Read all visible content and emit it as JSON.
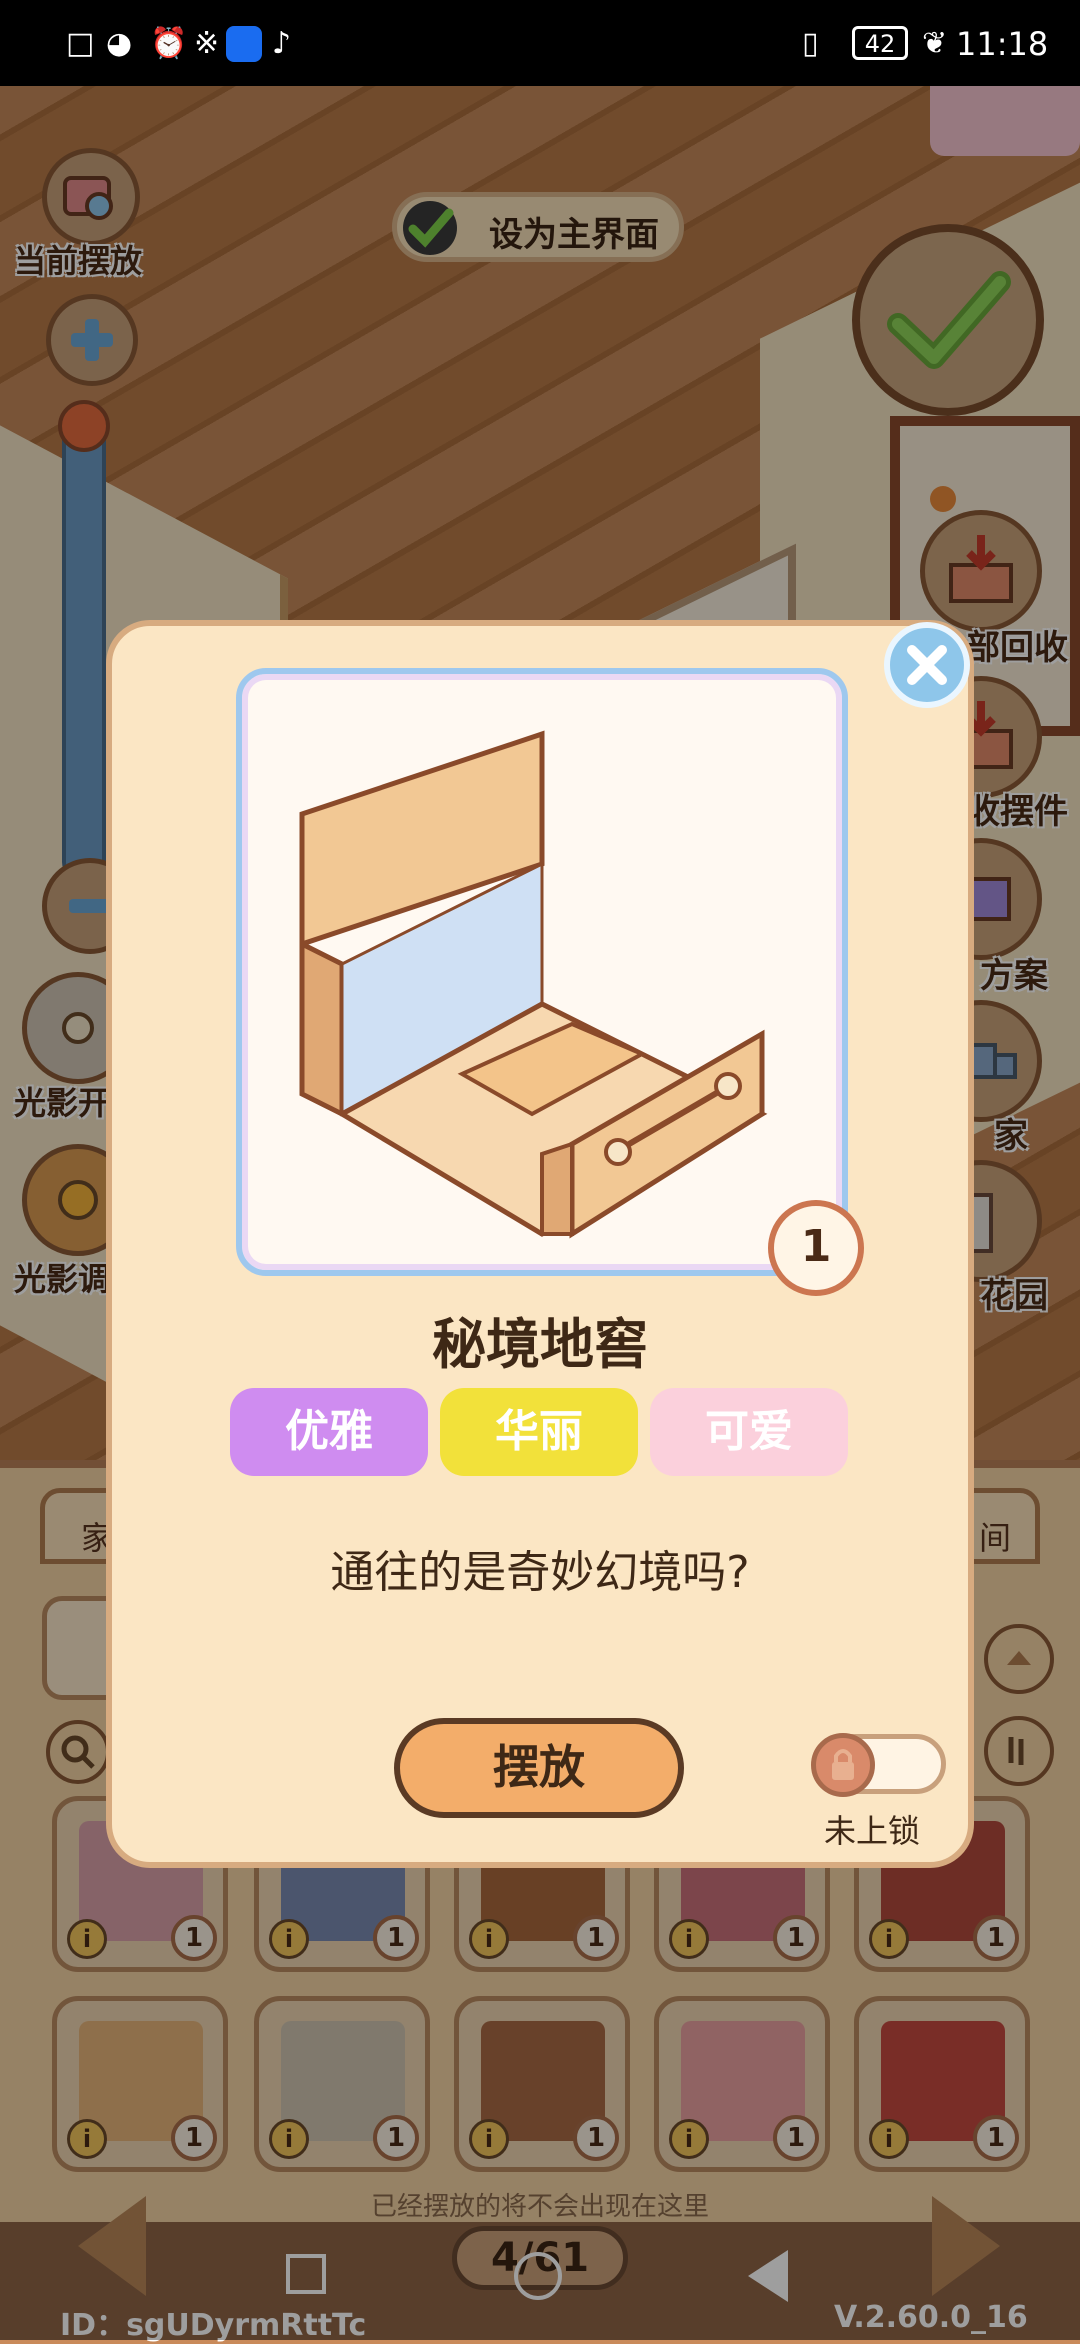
{
  "status_bar": {
    "time": "11:18",
    "battery": "42"
  },
  "scene": {
    "set_main_label": "设为主界面",
    "left_controls": {
      "current_placement_label": "当前摆放",
      "light_toggle_label": "光影开",
      "light_adjust_label": "光影调"
    },
    "right_controls": {
      "recycle_label": "部回收",
      "take_back_label": "收摆件",
      "plan_label": "方案",
      "move_label": "家",
      "garden_label": "花园"
    },
    "tabs": {
      "left": "家",
      "right": "间"
    },
    "items": [
      {
        "count": "1",
        "color": "#d8a0a8"
      },
      {
        "count": "1",
        "color": "#7a8ab0"
      },
      {
        "count": "1",
        "color": "#a8683c"
      },
      {
        "count": "1",
        "color": "#c8707a"
      },
      {
        "count": "1",
        "color": "#b04a3c"
      },
      {
        "count": "1",
        "color": "#e6b47a"
      },
      {
        "count": "1",
        "color": "#cfc4b0"
      },
      {
        "count": "1",
        "color": "#a86a44"
      },
      {
        "count": "1",
        "color": "#e8a0a0"
      },
      {
        "count": "1",
        "color": "#c44a40"
      }
    ],
    "hint": "已经摆放的将不会出现在这里",
    "page_indicator": "4/61",
    "user_id": "ID：sgUDyrmRttTc",
    "version": "V.2.60.0_16"
  },
  "modal": {
    "quantity": "1",
    "title": "秘境地窖",
    "tags": [
      {
        "label": "优雅",
        "bg": "#cf8cf0",
        "fg": "#ffffff"
      },
      {
        "label": "华丽",
        "bg": "#f2e13a",
        "fg": "#ffffff"
      },
      {
        "label": "可爱",
        "bg": "#fbd0dc",
        "fg": "#ffffff"
      }
    ],
    "description": "通往的是奇妙幻境吗?",
    "place_button": "摆放",
    "lock_label": "未上锁"
  }
}
